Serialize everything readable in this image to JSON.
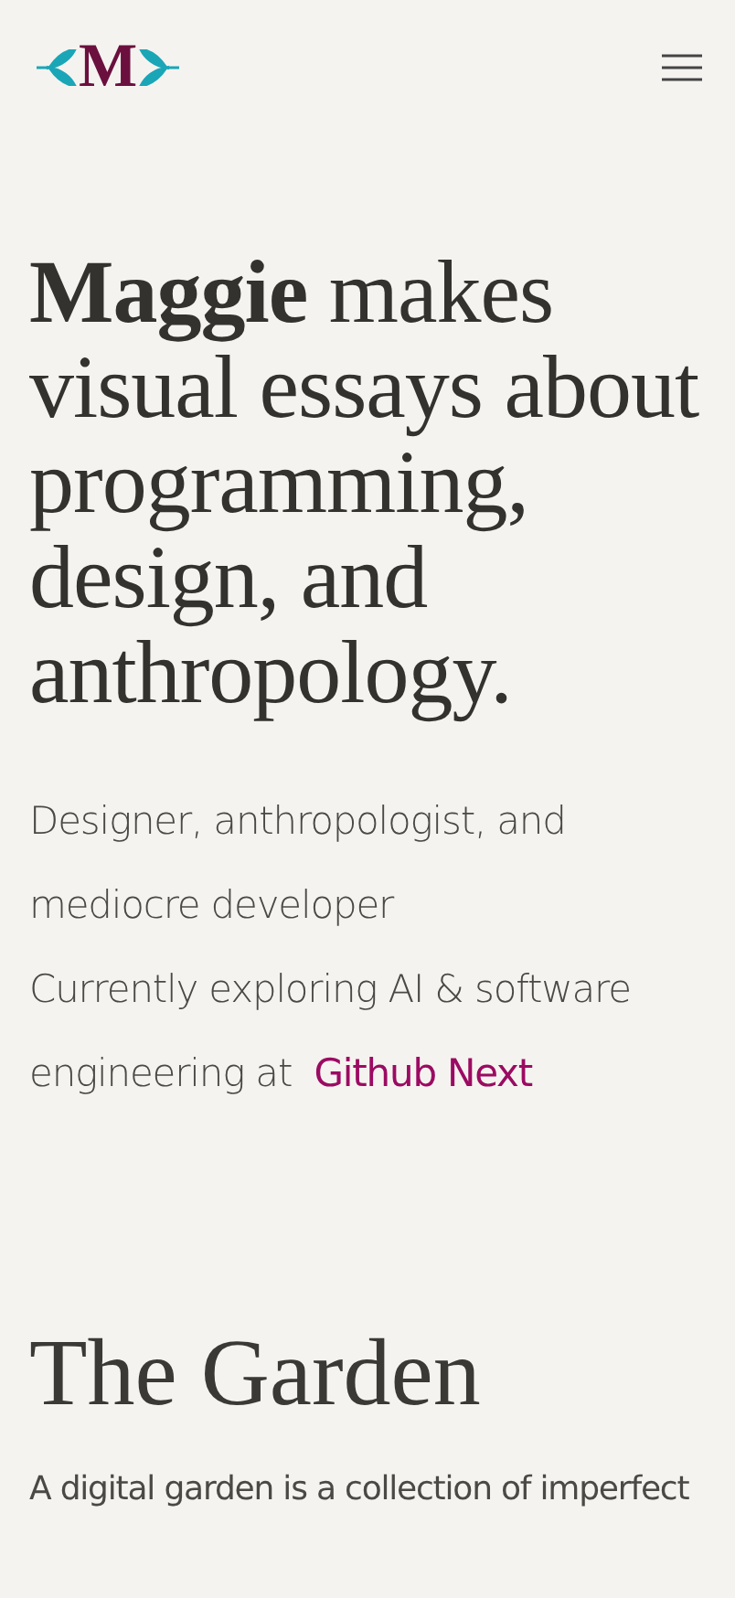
{
  "header": {
    "logo_letter": "M"
  },
  "hero": {
    "headline": "**Maggie** makes visual essays about programming, design, and anthropology.",
    "intro": "Designer, anthropologist, and mediocre developer",
    "current": "Currently exploring AI & software engineering at",
    "link": "Github Next"
  },
  "garden": {
    "title": "The Garden",
    "description": "A digital garden is a collection of imperfect"
  }
}
